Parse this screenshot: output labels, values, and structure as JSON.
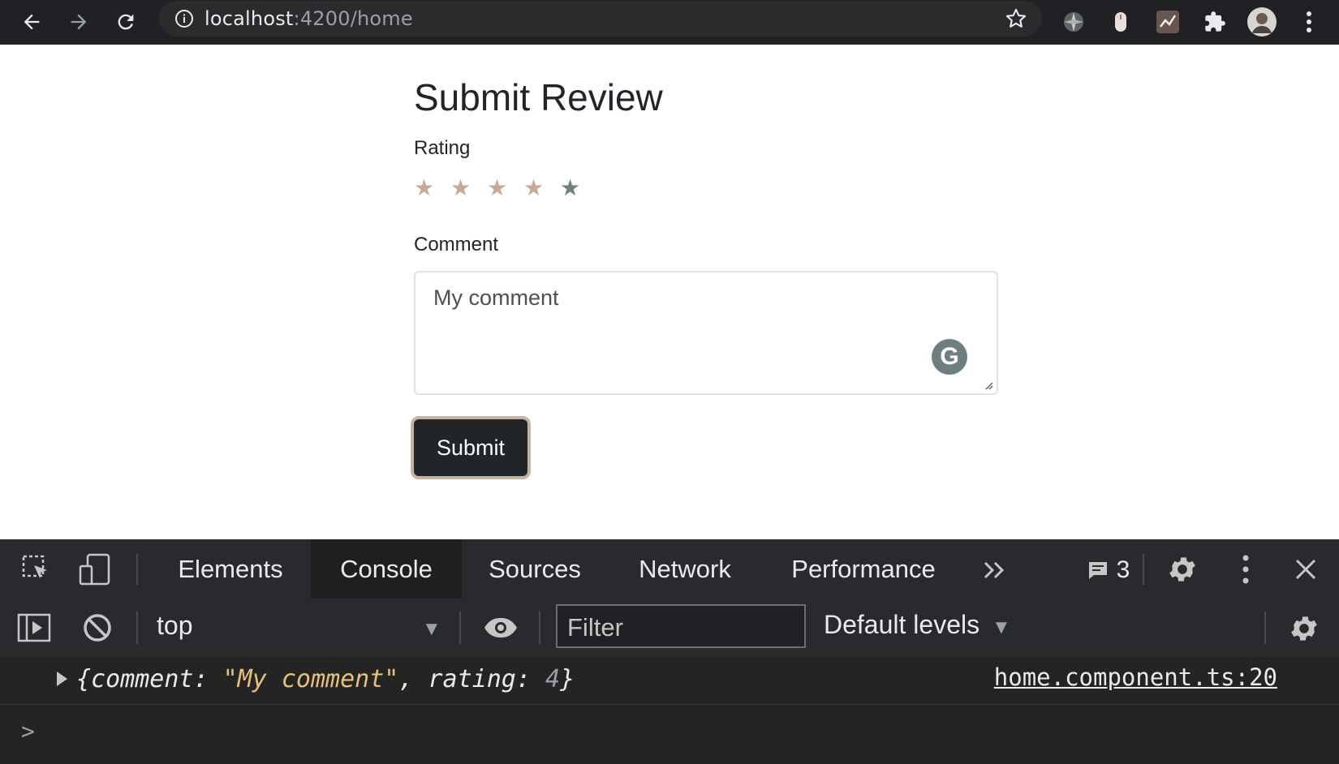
{
  "browser": {
    "url_host": "localhost",
    "url_rest": ":4200/home"
  },
  "page": {
    "title": "Submit Review",
    "rating_label": "Rating",
    "rating": {
      "value": 4,
      "max": 5
    },
    "comment_label": "Comment",
    "comment_value": "My comment",
    "submit_label": "Submit",
    "colors": {
      "star_filled": "#c8a993",
      "star_empty": "#6f7f80",
      "button_bg": "#212529"
    }
  },
  "devtools": {
    "tabs": [
      "Elements",
      "Console",
      "Sources",
      "Network",
      "Performance"
    ],
    "active_tab": "Console",
    "message_count": "3",
    "context": "top",
    "filter_placeholder": "Filter",
    "levels": "Default levels",
    "log": {
      "prefix": "{comment: ",
      "comment_str": "\"My comment\"",
      "mid": ", rating: ",
      "rating_num": "4",
      "suffix": "}",
      "source": "home.component.ts:20"
    },
    "prompt": ">"
  }
}
